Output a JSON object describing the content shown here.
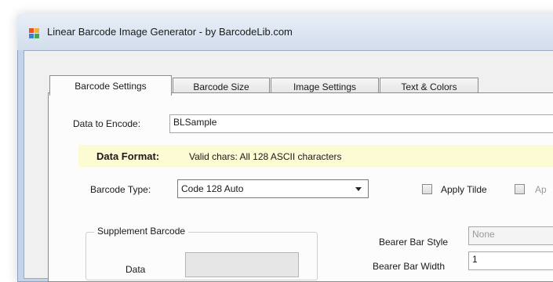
{
  "window": {
    "title": "Linear Barcode Image Generator - by BarcodeLib.com",
    "icon": "barcodelib-app-icon"
  },
  "tabs": [
    {
      "label": "Barcode Settings",
      "active": true
    },
    {
      "label": "Barcode Size",
      "active": false
    },
    {
      "label": "Image Settings",
      "active": false
    },
    {
      "label": "Text & Colors",
      "active": false
    }
  ],
  "form": {
    "data_label": "Data to Encode:",
    "data_value": "BLSample",
    "format_label": "Data Format:",
    "format_text": "Valid chars: All 128 ASCII characters",
    "type_label": "Barcode Type:",
    "type_value": "Code 128 Auto",
    "apply_tilde_label": "Apply Tilde",
    "apply_partial_label": "Ap",
    "supplement_group": "Supplement Barcode",
    "supplement_data_label": "Data",
    "bearer_style_label": "Bearer Bar Style",
    "bearer_style_value": "None",
    "bearer_width_label": "Bearer Bar Width",
    "bearer_width_value": "1"
  },
  "colors": {
    "format_highlight": "#fdfbd3",
    "titlebar": "#d2deec"
  }
}
